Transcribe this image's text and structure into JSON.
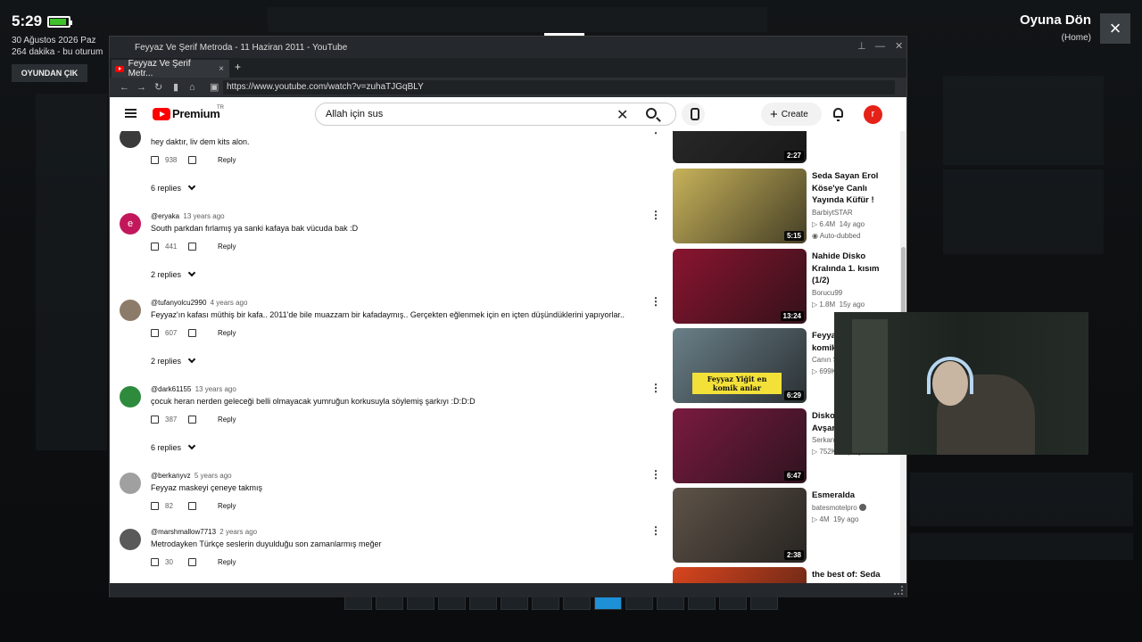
{
  "overlay": {
    "time": "5:29",
    "date_line": "30 Ağustos 2026 Paz",
    "session_line": "264 dakika - bu oturum",
    "exit_label": "OYUNDAN ÇIK",
    "return_label": "Oyuna Dön",
    "return_sub": "(Home)",
    "close_icon": "×",
    "battery_level": 0.9,
    "battery_color": "#3ec12b"
  },
  "browser": {
    "window_title": "Feyyaz Ve Şerif Metroda - 11 Haziran 2011 - YouTube",
    "tab_label": "Feyyaz Ve Şerif Metr...",
    "tab_close": "×",
    "new_tab": "+",
    "url": "https://www.youtube.com/watch?v=zuhaTJGqBLY",
    "nav_icons": [
      "arrow-left-icon",
      "arrow-right-icon",
      "reload-icon",
      "bookmark-icon",
      "home-icon",
      "lock-icon"
    ]
  },
  "youtube": {
    "logo_text": "Premium",
    "region": "TR",
    "search_value": "Allah için sus",
    "clear_icon": "✕",
    "create_label": "Create",
    "create_plus": "+",
    "avatar_letter": "r",
    "accent": "#ff0000"
  },
  "comments": [
    {
      "user": "",
      "date": "",
      "text": "hey daktır, liv dem kits alon.",
      "likes": "938",
      "reply": "Reply",
      "replies": "6 replies",
      "avatar_color": "#3a3a3a",
      "avatar_letter": ""
    },
    {
      "user": "@eryaka",
      "date": "13 years ago",
      "text": "South parkdan fırlamış ya sanki kafaya bak vücuda bak :D",
      "likes": "441",
      "reply": "Reply",
      "replies": "2 replies",
      "avatar_color": "#c2185b",
      "avatar_letter": "e"
    },
    {
      "user": "@tufanyolcu2990",
      "date": "4 years ago",
      "text": "Feyyaz'ın kafası müthiş bir kafa.. 2011'de bile muazzam bir kafadaymış.. Gerçekten eğlenmek için en içten düşündüklerini yapıyorlar..",
      "likes": "607",
      "reply": "Reply",
      "replies": "2 replies",
      "avatar_color": "#8d7b6a",
      "avatar_letter": ""
    },
    {
      "user": "@dark61155",
      "date": "13 years ago",
      "text": "çocuk heran nerden geleceği belli olmayacak yumruğun korkusuyla söylemiş şarkıyı :D:D:D",
      "likes": "387",
      "reply": "Reply",
      "replies": "6 replies",
      "avatar_color": "#2e8b3d",
      "avatar_letter": ""
    },
    {
      "user": "@berkanyvz",
      "date": "5 years ago",
      "text": "Feyyaz maskeyi çeneye takmış",
      "likes": "82",
      "reply": "Reply",
      "replies": "",
      "avatar_color": "#a0a0a0",
      "avatar_letter": ""
    },
    {
      "user": "@marshmallow7713",
      "date": "2 years ago",
      "text": "Metrodayken Türkçe seslerin duyulduğu son zamanlarmış meğer",
      "likes": "30",
      "reply": "Reply",
      "replies": "",
      "avatar_color": "#5a5a5a",
      "avatar_letter": ""
    }
  ],
  "sidebar_videos": [
    {
      "title": "",
      "channel": "",
      "views": "",
      "age": "",
      "duration": "2:27",
      "badge": "",
      "thumb_color": "#2b2b2b"
    },
    {
      "title": "Seda Sayan Erol Köse'ye Canlı Yayında Küfür !",
      "channel": "BarbiytSTAR",
      "views": "6.4M",
      "age": "14y ago",
      "duration": "5:15",
      "badge": "Auto-dubbed",
      "thumb_color": "#c7b25a"
    },
    {
      "title": "Nahide Disko Kralında 1. kısım (1/2)",
      "channel": "Borucu99",
      "views": "1.8M",
      "age": "15y ago",
      "duration": "13:24",
      "badge": "",
      "thumb_color": "#8a1430"
    },
    {
      "title": "Feyyaz Yiğit en komik anlar",
      "channel": "Canın S",
      "views": "699K",
      "age": "",
      "duration": "6:29",
      "badge": "",
      "thumb_color": "#6a7f88",
      "thumb_caption": "Feyyaz Yiğit en komik anlar"
    },
    {
      "title": "Disko Kralı 02.04. Avşar",
      "channel": "Serkan",
      "views": "752K",
      "age": "15y ago",
      "duration": "6:47",
      "badge": "",
      "thumb_color": "#7a1a40"
    },
    {
      "title": "Esmeralda",
      "channel": "batesmotelpro",
      "views": "4M",
      "age": "19y ago",
      "duration": "2:38",
      "badge": "",
      "thumb_color": "#5e5348"
    },
    {
      "title": "the best of: Seda Sayan",
      "channel": "",
      "views": "",
      "age": "",
      "duration": "",
      "badge": "",
      "thumb_color": "#d9451e"
    }
  ]
}
